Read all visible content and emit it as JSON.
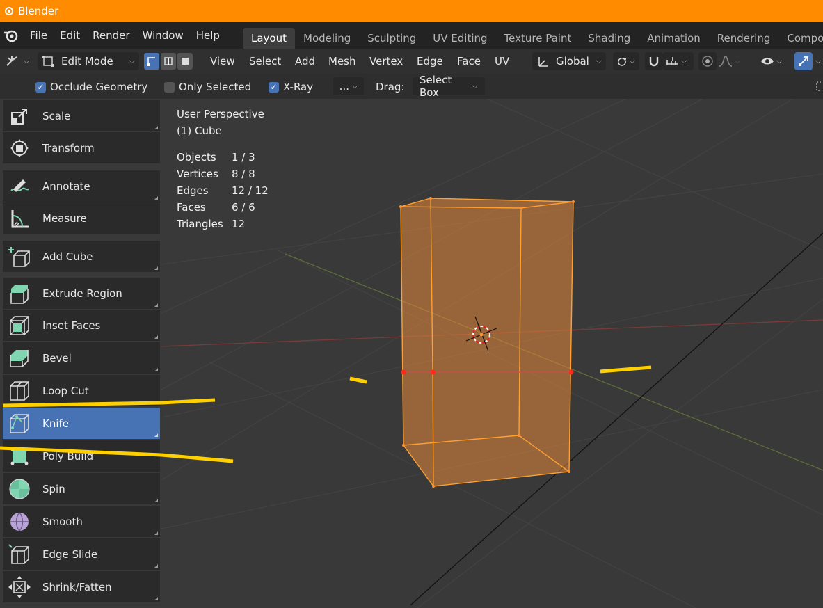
{
  "window": {
    "title": "Blender"
  },
  "menu": [
    "File",
    "Edit",
    "Render",
    "Window",
    "Help"
  ],
  "workspaces": [
    "Layout",
    "Modeling",
    "Sculpting",
    "UV Editing",
    "Texture Paint",
    "Shading",
    "Animation",
    "Rendering",
    "Compo"
  ],
  "header": {
    "mode": "Edit Mode",
    "menus": [
      "View",
      "Select",
      "Add",
      "Mesh",
      "Vertex",
      "Edge",
      "Face",
      "UV"
    ],
    "transform_orientation": "Global"
  },
  "tool_settings": {
    "occlude_geometry": {
      "label": "Occlude Geometry",
      "checked": true
    },
    "only_selected": {
      "label": "Only Selected",
      "checked": false
    },
    "xray": {
      "label": "X-Ray",
      "checked": true
    },
    "more": "...",
    "drag_label": "Drag:",
    "drag_value": "Select Box"
  },
  "tools": [
    {
      "label": "Scale",
      "icon": "scale-icon",
      "active": false
    },
    {
      "label": "Transform",
      "icon": "transform-icon",
      "active": false
    },
    {
      "label": "Annotate",
      "icon": "annotate-icon",
      "active": false
    },
    {
      "label": "Measure",
      "icon": "measure-icon",
      "active": false
    },
    {
      "label": "Add Cube",
      "icon": "add-cube-icon",
      "active": false
    },
    {
      "label": "Extrude Region",
      "icon": "extrude-region-icon",
      "active": false
    },
    {
      "label": "Inset Faces",
      "icon": "inset-faces-icon",
      "active": false
    },
    {
      "label": "Bevel",
      "icon": "bevel-icon",
      "active": false
    },
    {
      "label": "Loop Cut",
      "icon": "loop-cut-icon",
      "active": false
    },
    {
      "label": "Knife",
      "icon": "knife-icon",
      "active": true
    },
    {
      "label": "Poly Build",
      "icon": "poly-build-icon",
      "active": false
    },
    {
      "label": "Spin",
      "icon": "spin-icon",
      "active": false
    },
    {
      "label": "Smooth",
      "icon": "smooth-icon",
      "active": false
    },
    {
      "label": "Edge Slide",
      "icon": "edge-slide-icon",
      "active": false
    },
    {
      "label": "Shrink/Fatten",
      "icon": "shrink-fatten-icon",
      "active": false
    }
  ],
  "viewport": {
    "view_name": "User Perspective",
    "object_name": "(1) Cube",
    "stats": [
      {
        "label": "Objects",
        "value": "1 / 3"
      },
      {
        "label": "Vertices",
        "value": "8 / 8"
      },
      {
        "label": "Edges",
        "value": "12 / 12"
      },
      {
        "label": "Faces",
        "value": "6 / 6"
      },
      {
        "label": "Triangles",
        "value": "12"
      }
    ]
  },
  "colors": {
    "title_bar": "#ff8c00",
    "active_tool": "#4772b3",
    "mesh_face": "#e8883a",
    "mesh_edge": "#ffa030",
    "vertex": "#ff2a1a",
    "annotation": "#ffd000"
  }
}
